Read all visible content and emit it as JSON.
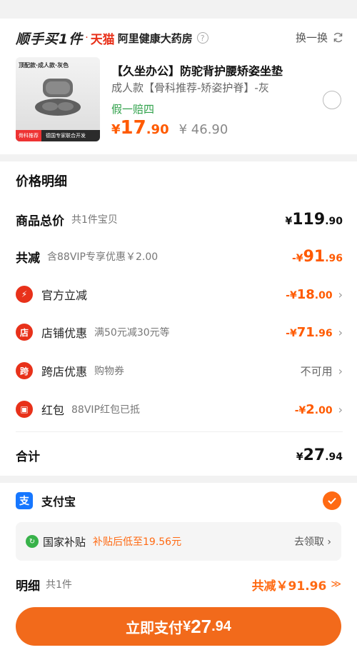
{
  "store": {
    "brand_sf": "顺手买1件",
    "brand_dot": "·",
    "brand_tmall": "天猫",
    "store_name": "阿里健康大药房",
    "help_icon": "?",
    "swap_label": "换一换"
  },
  "product": {
    "image_tag": "顶配款·成人款·灰色",
    "image_badge": "骨科推荐",
    "image_caption": "德国专家联合开发",
    "title": "【久坐办公】防驼背护腰矫姿坐垫",
    "spec": "成人款【骨科推荐-矫姿护脊】-灰",
    "promo": "假一赔四",
    "price_currency": "¥",
    "price_int": "17",
    "price_dec": ".90",
    "orig_price": "¥ 46.90"
  },
  "price_detail": {
    "title": "价格明细",
    "total_label": "商品总价",
    "total_sub": "共1件宝贝",
    "total_cur": "¥",
    "total_int": "119",
    "total_dec": ".90",
    "reduce_label": "共减",
    "reduce_sub": "含88VIP专享优惠￥2.00",
    "reduce_cur": "-¥",
    "reduce_int": "91",
    "reduce_dec": ".96",
    "items": [
      {
        "icon": "⚡",
        "label": "官方立减",
        "sub": "",
        "cur": "-¥",
        "int": "18",
        "dec": ".00",
        "color": "#e8311a"
      },
      {
        "icon": "店",
        "label": "店铺优惠",
        "sub": "满50元减30元等",
        "cur": "-¥",
        "int": "71",
        "dec": ".96",
        "color": "#e8311a"
      },
      {
        "icon": "跨",
        "label": "跨店优惠",
        "sub": "购物券",
        "value": "不可用",
        "color": "#e8311a"
      },
      {
        "icon": "▣",
        "label": "红包",
        "sub": "88VIP红包已抵",
        "cur": "-¥",
        "int": "2",
        "dec": ".00",
        "color": "#e8311a"
      }
    ],
    "sum_label": "合计",
    "sum_cur": "¥",
    "sum_int": "27",
    "sum_dec": ".94"
  },
  "payment": {
    "logo": "支",
    "method": "支付宝",
    "subsidy_icon": "↻",
    "subsidy_label": "国家补贴",
    "subsidy_desc": "补贴后低至19.56元",
    "subsidy_claim": "去领取 ›",
    "detail_label": "明细",
    "detail_count": "共1件",
    "detail_save": "共减￥91.96",
    "detail_chev": "≫",
    "pay_text": "立即支付",
    "pay_cur": "¥",
    "pay_int": "27",
    "pay_dec": ".94"
  },
  "colors": {
    "accent": "#ff5a00",
    "button": "#f26a1b",
    "alipay": "#1677ff",
    "green": "#2fa14a",
    "red": "#e8311a"
  }
}
